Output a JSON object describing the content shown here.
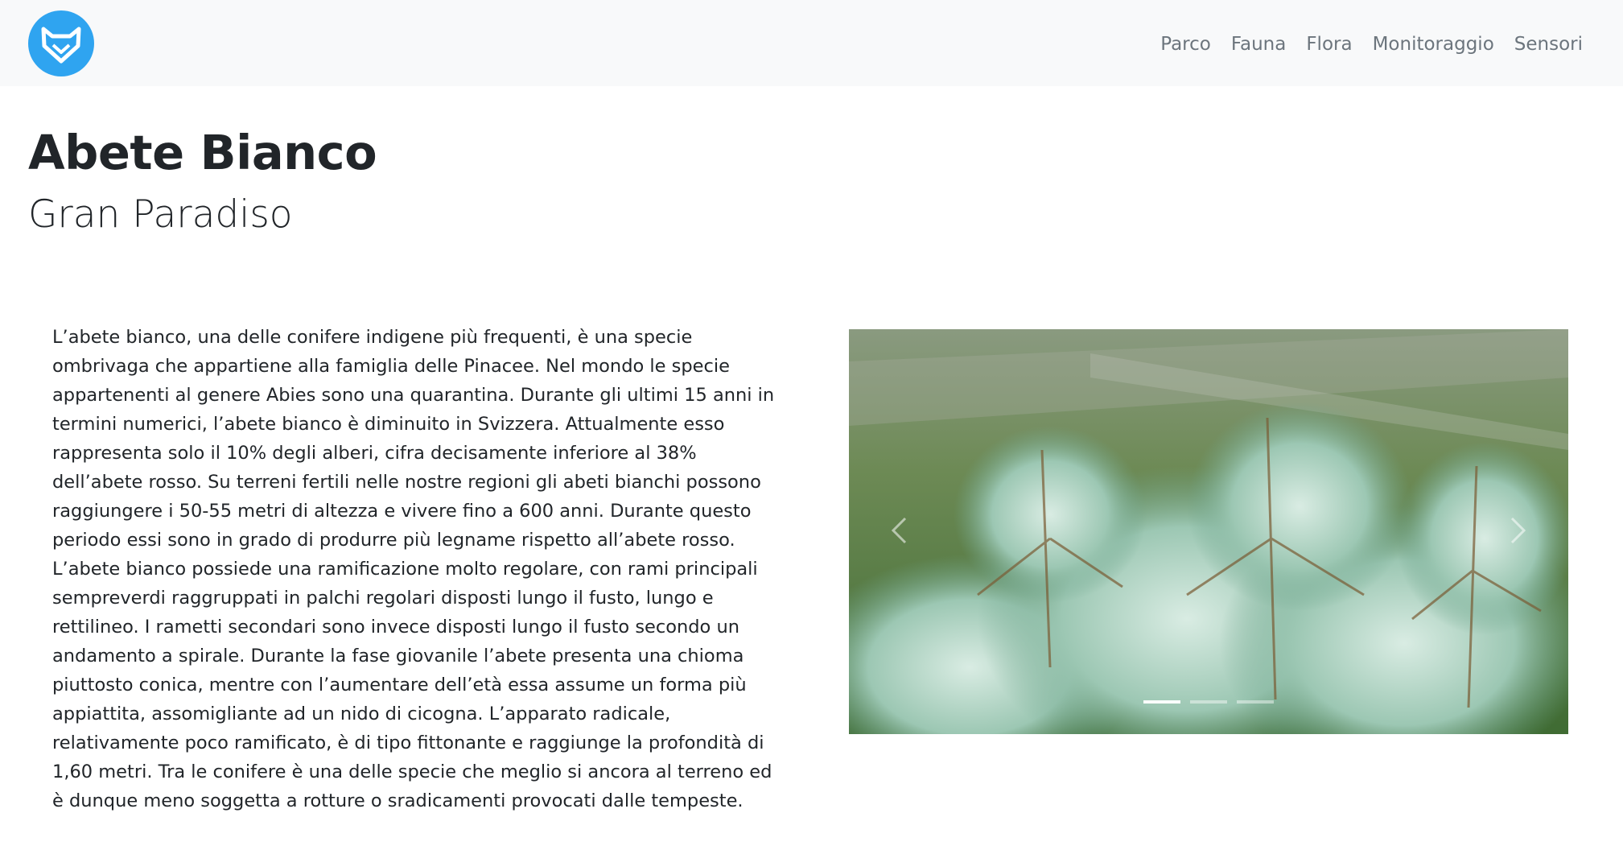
{
  "navbar": {
    "logo_icon": "fox-logo-icon",
    "brand_color": "#2fa4f0",
    "links": [
      "Parco",
      "Fauna",
      "Flora",
      "Monitoraggio",
      "Sensori"
    ]
  },
  "page": {
    "title": "Abete Bianco",
    "subtitle": "Gran Paradiso",
    "description": "L’abete bianco, una delle conifere indigene più frequenti, è una specie ombrivaga che appartiene alla famiglia delle Pinacee. Nel mondo le specie appartenenti al genere Abies sono una quarantina. Durante gli ultimi 15 anni in termini numerici, l’abete bianco è diminuito in Svizzera. Attualmente esso rappresenta solo il 10% degli alberi, cifra decisamente inferiore al 38% dell’abete rosso. Su terreni fertili nelle nostre regioni gli abeti bianchi possono raggiungere i 50-55 metri di altezza e vivere fino a 600 anni. Durante questo periodo essi sono in grado di produrre più legname rispetto all’abete rosso. L’abete bianco possiede una ramificazione molto regolare, con rami principali sempreverdi raggruppati in palchi regolari disposti lungo il fusto, lungo e rettilineo. I rametti secondari sono invece disposti lungo il fusto secondo un andamento a spirale. Durante la fase giovanile l’abete presenta una chioma piuttosto conica, mentre con l’aumentare dell’età essa assume un forma più appiattita, assomigliante ad un nido di cicogna. L’apparato radicale, relativamente poco ramificato, è di tipo fittonante e raggiunge la profondità di 1,60 metri. Tra le conifere è una delle specie che meglio si ancora al terreno ed è dunque meno soggetta a rotture o sradicamenti provocati dalle tempeste."
  },
  "carousel": {
    "image": "fir-branches-photo",
    "prev_icon": "chevron-left-icon",
    "next_icon": "chevron-right-icon",
    "slide_count": 3,
    "active_index": 0
  }
}
